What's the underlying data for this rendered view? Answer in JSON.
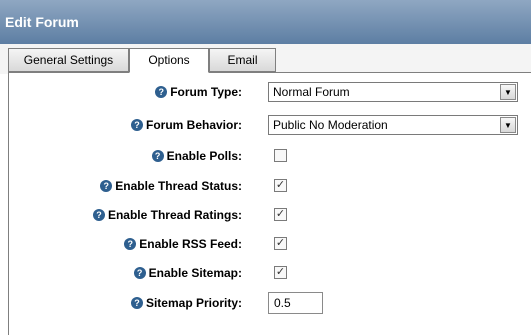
{
  "header": {
    "title": "Edit Forum"
  },
  "tabs": [
    {
      "label": "General Settings"
    },
    {
      "label": "Options"
    },
    {
      "label": "Email"
    }
  ],
  "form": {
    "forum_type": {
      "label": "Forum Type:",
      "value": "Normal Forum"
    },
    "forum_behavior": {
      "label": "Forum Behavior:",
      "value": "Public No Moderation"
    },
    "enable_polls": {
      "label": "Enable Polls:",
      "checked": false
    },
    "enable_thread_status": {
      "label": "Enable Thread Status:",
      "checked": true
    },
    "enable_thread_ratings": {
      "label": "Enable Thread Ratings:",
      "checked": true
    },
    "enable_rss_feed": {
      "label": "Enable RSS Feed:",
      "checked": true
    },
    "enable_sitemap": {
      "label": "Enable Sitemap:",
      "checked": true
    },
    "sitemap_priority": {
      "label": "Sitemap Priority:",
      "value": "0.5"
    }
  },
  "icons": {
    "help": "help-icon",
    "dropdown": "chevron-down-icon",
    "check": "checkmark-icon"
  },
  "glyphs": {
    "help": "?",
    "dropdown": "▼",
    "check": "✓",
    "unchecked": ""
  },
  "colors": {
    "header_top": "#8fa7c2",
    "header_bottom": "#5d7ea3",
    "help_icon": "#2e5f8f"
  }
}
